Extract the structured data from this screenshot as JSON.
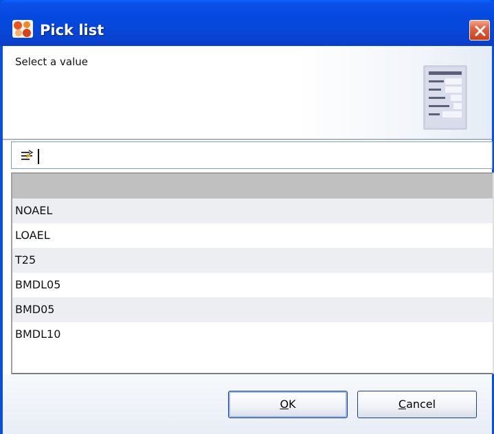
{
  "window": {
    "title": "Pick list",
    "app_icon": "app-logo-icon",
    "close_icon": "close-icon"
  },
  "header": {
    "message": "Select a value",
    "icon": "list-form-icon"
  },
  "filter": {
    "icon": "filter-icon",
    "value": "",
    "placeholder": ""
  },
  "list": {
    "items": [
      {
        "label": "",
        "selected": true
      },
      {
        "label": "NOAEL",
        "selected": false
      },
      {
        "label": "LOAEL",
        "selected": false
      },
      {
        "label": "T25",
        "selected": false
      },
      {
        "label": "BMDL05",
        "selected": false
      },
      {
        "label": "BMD05",
        "selected": false
      },
      {
        "label": "BMDL10",
        "selected": false
      }
    ]
  },
  "buttons": {
    "ok": {
      "mnemonic": "O",
      "rest": "K"
    },
    "cancel": {
      "mnemonic": "C",
      "rest": "ancel"
    }
  },
  "colors": {
    "titlebar": "#0548de",
    "selected_row": "#c0c0c0",
    "alt_row": "#eceef2",
    "close_button": "#e2623d"
  }
}
